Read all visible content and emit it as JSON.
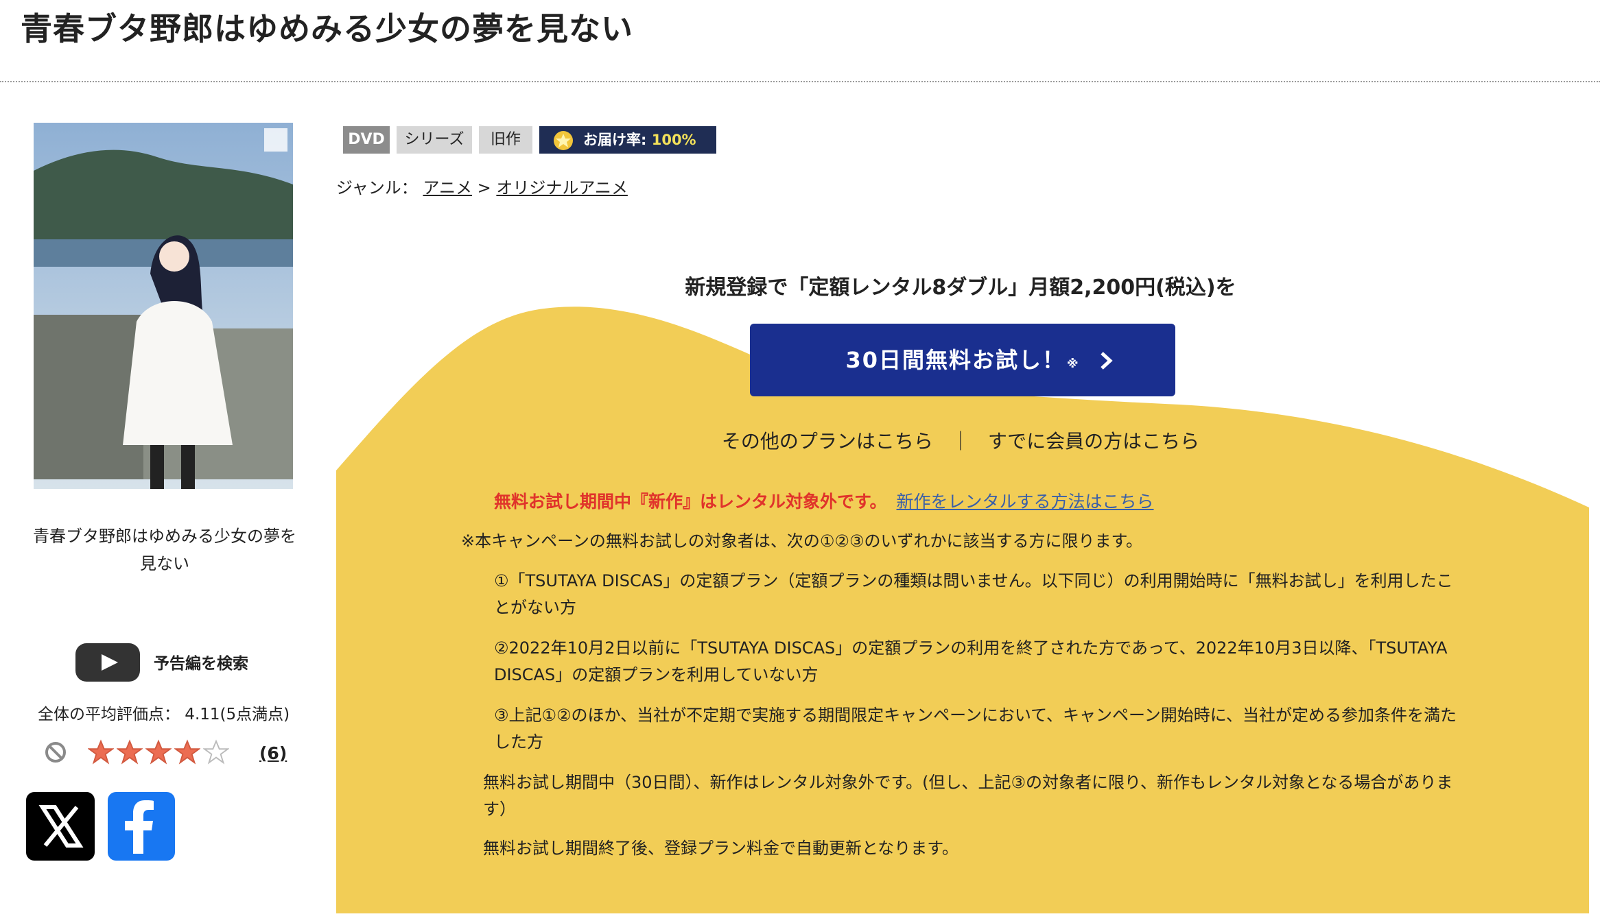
{
  "page": {
    "title": "青春ブタ野郎はゆめみる少女の夢を見ない"
  },
  "product": {
    "caption": "青春ブタ野郎はゆめみる少女の夢を見ない",
    "trailer_label": "予告編を検索",
    "rating_text": "全体の平均評価点： 4.11(5点満点)",
    "rating_value": 4.11,
    "rating_max": 5,
    "review_count": "(6)"
  },
  "tags": {
    "format": "DVD",
    "series": "シリーズ",
    "old": "旧作",
    "delivery_label": "お届け率:",
    "delivery_value": "100%"
  },
  "genre": {
    "label": "ジャンル：",
    "items": [
      "アニメ",
      "オリジナルアニメ"
    ],
    "separator": ">"
  },
  "campaign": {
    "heading": "新規登録で「定額レンタル8ダブル」月額2,200円(税込)を",
    "button_label": "30日間無料お試し！",
    "button_note": "※",
    "other_plans": "その他のプランはこちら",
    "separator": "｜",
    "member_link": "すでに会員の方はこちら",
    "notice_red": "無料お試し期間中『新作』はレンタル対象外です。",
    "notice_link": "新作をレンタルする方法はこちら",
    "eligibility_lead": "※本キャンペーンの無料お試しの対象者は、次の①②③のいずれかに該当する方に限ります。",
    "conditions": [
      "①「TSUTAYA DISCAS」の定額プラン（定額プランの種類は問いません。以下同じ）の利用開始時に「無料お試し」を利用したことがない方",
      "②2022年10月2日以前に「TSUTAYA DISCAS」の定額プランの利用を終了された方であって、2022年10月3日以降、「TSUTAYA DISCAS」の定額プランを利用していない方",
      "③上記①②のほか、当社が不定期で実施する期間限定キャンペーンにおいて、キャンペーン開始時に、当社が定める参加条件を満たした方"
    ],
    "trial_info": "無料お試し期間中（30日間）、新作はレンタル対象外です。(但し、上記③の対象者に限り、新作もレンタル対象となる場合があります）",
    "renewal": "無料お試し期間終了後、登録プラン料金で自動更新となります。"
  },
  "colors": {
    "campaign_bg": "#f2cd56",
    "button_bg": "#1a2f8f",
    "notice_red": "#e0332b",
    "link_blue": "#3a5fa8",
    "delivery_bg": "#1f2d54",
    "star_fill": "#ec6d52"
  },
  "icons": {
    "trailer": "play-icon",
    "no_interest": "prohibited-icon",
    "share_x": "x-logo-icon",
    "share_facebook": "facebook-icon",
    "trial_arrow": "chevron-right-icon",
    "delivery": "star-icon"
  }
}
